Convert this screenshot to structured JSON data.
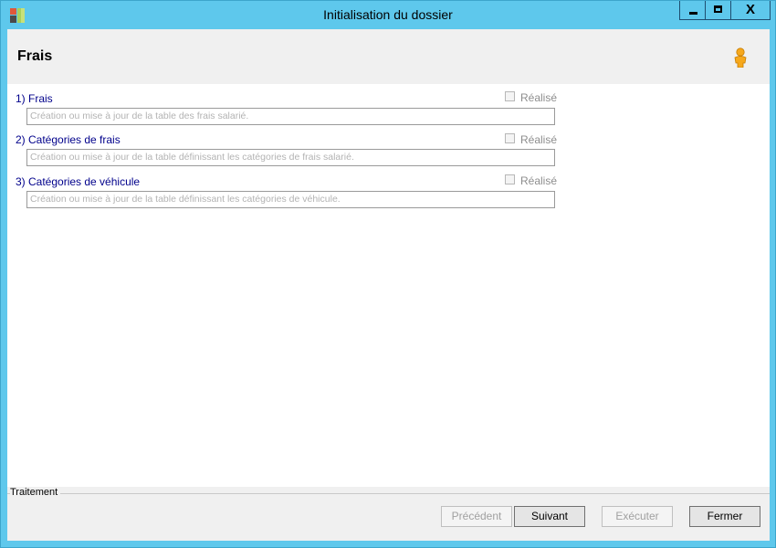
{
  "window": {
    "title": "Initialisation du dossier",
    "controls": {
      "minimize": "minimize",
      "maximize": "maximize",
      "close": "X"
    }
  },
  "header": {
    "title": "Frais",
    "icon": "user-icon"
  },
  "steps": [
    {
      "label": "1) Frais",
      "done_label": "Réalisé",
      "done_checked": false,
      "description": "Création ou mise à jour de la table des frais salarié."
    },
    {
      "label": "2) Catégories de frais",
      "done_label": "Réalisé",
      "done_checked": false,
      "description": "Création ou mise à jour de la table définissant les catégories de frais salarié."
    },
    {
      "label": "3) Catégories de véhicule",
      "done_label": "Réalisé",
      "done_checked": false,
      "description": "Création ou mise à jour de la table définissant les catégories de véhicule."
    }
  ],
  "footer": {
    "group_label": "Traitement",
    "buttons": {
      "previous": "Précédent",
      "next": "Suivant",
      "execute": "Exécuter",
      "close": "Fermer"
    }
  },
  "colors": {
    "titlebar": "#5ec8ec",
    "label_text": "#00008b",
    "panel": "#f0f0f0"
  }
}
